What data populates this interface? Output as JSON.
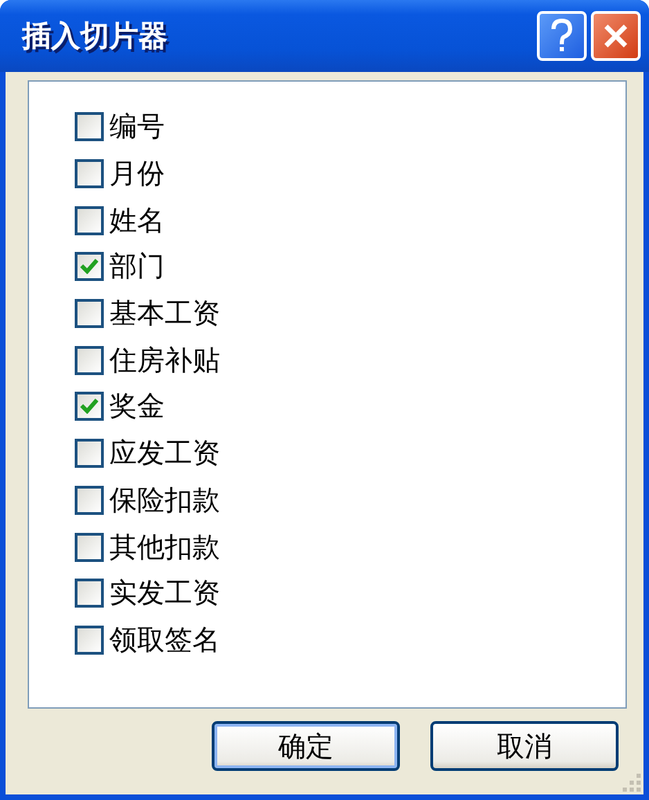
{
  "window": {
    "title": "插入切片器"
  },
  "fields": [
    {
      "label": "编号",
      "checked": false
    },
    {
      "label": "月份",
      "checked": false
    },
    {
      "label": "姓名",
      "checked": false
    },
    {
      "label": "部门",
      "checked": true
    },
    {
      "label": "基本工资",
      "checked": false
    },
    {
      "label": "住房补贴",
      "checked": false
    },
    {
      "label": "奖金",
      "checked": true
    },
    {
      "label": "应发工资",
      "checked": false
    },
    {
      "label": "保险扣款",
      "checked": false
    },
    {
      "label": "其他扣款",
      "checked": false
    },
    {
      "label": "实发工资",
      "checked": false
    },
    {
      "label": "领取签名",
      "checked": false
    }
  ],
  "buttons": [
    {
      "label": "确定",
      "default": true
    },
    {
      "label": "取消",
      "default": false
    }
  ]
}
